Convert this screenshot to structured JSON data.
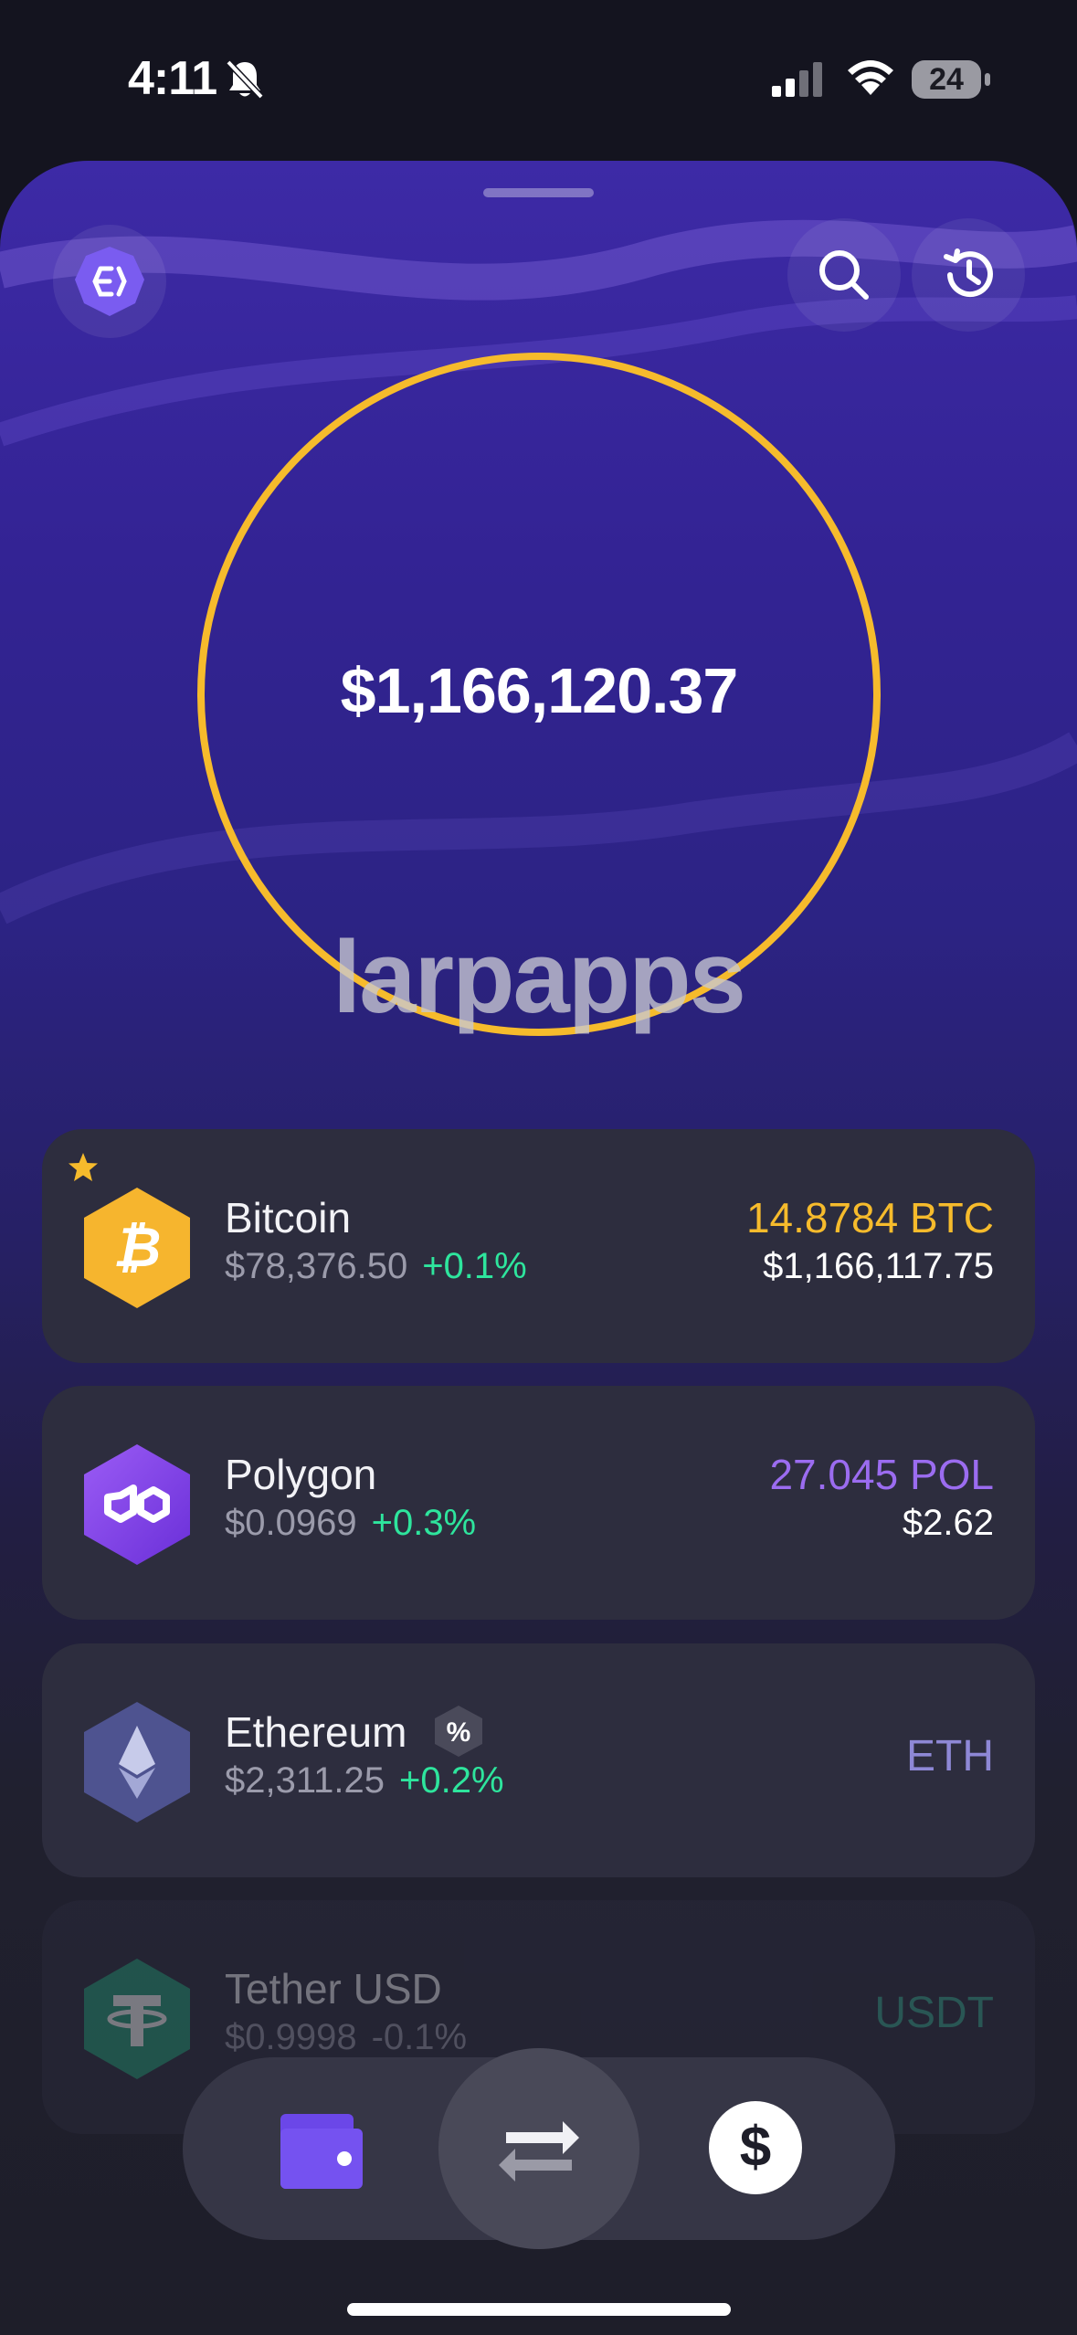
{
  "status_bar": {
    "time": "4:11",
    "battery": "24"
  },
  "portfolio": {
    "total_balance": "$1,166,120.37",
    "watermark": "larpapps",
    "ring_color": "#f6bb2c"
  },
  "assets": [
    {
      "name": "Bitcoin",
      "price": "$78,376.50",
      "change": "+0.1%",
      "amount": "14.8784 BTC",
      "value": "$1,166,117.75",
      "amount_color": "#f6bb2c",
      "icon": "bitcoin-icon",
      "favorite": true
    },
    {
      "name": "Polygon",
      "price": "$0.0969",
      "change": "+0.3%",
      "amount": "27.045 POL",
      "value": "$2.62",
      "amount_color": "#9b6cf0",
      "icon": "polygon-icon"
    },
    {
      "name": "Ethereum",
      "price": "$2,311.25",
      "change": "+0.2%",
      "ticker": "ETH",
      "ticker_color": "#8e88d6",
      "badge": "%",
      "icon": "ethereum-icon"
    },
    {
      "name": "Tether USD",
      "price": "$0.9998",
      "change": "-0.1%",
      "ticker": "USDT",
      "ticker_color": "#3aa890",
      "icon": "tether-icon"
    }
  ],
  "bottom_nav": {
    "dollar_label": "$"
  },
  "colors": {
    "positive": "#2ee59d",
    "accent_purple": "#6b47e8",
    "background": "#1e1e29"
  }
}
